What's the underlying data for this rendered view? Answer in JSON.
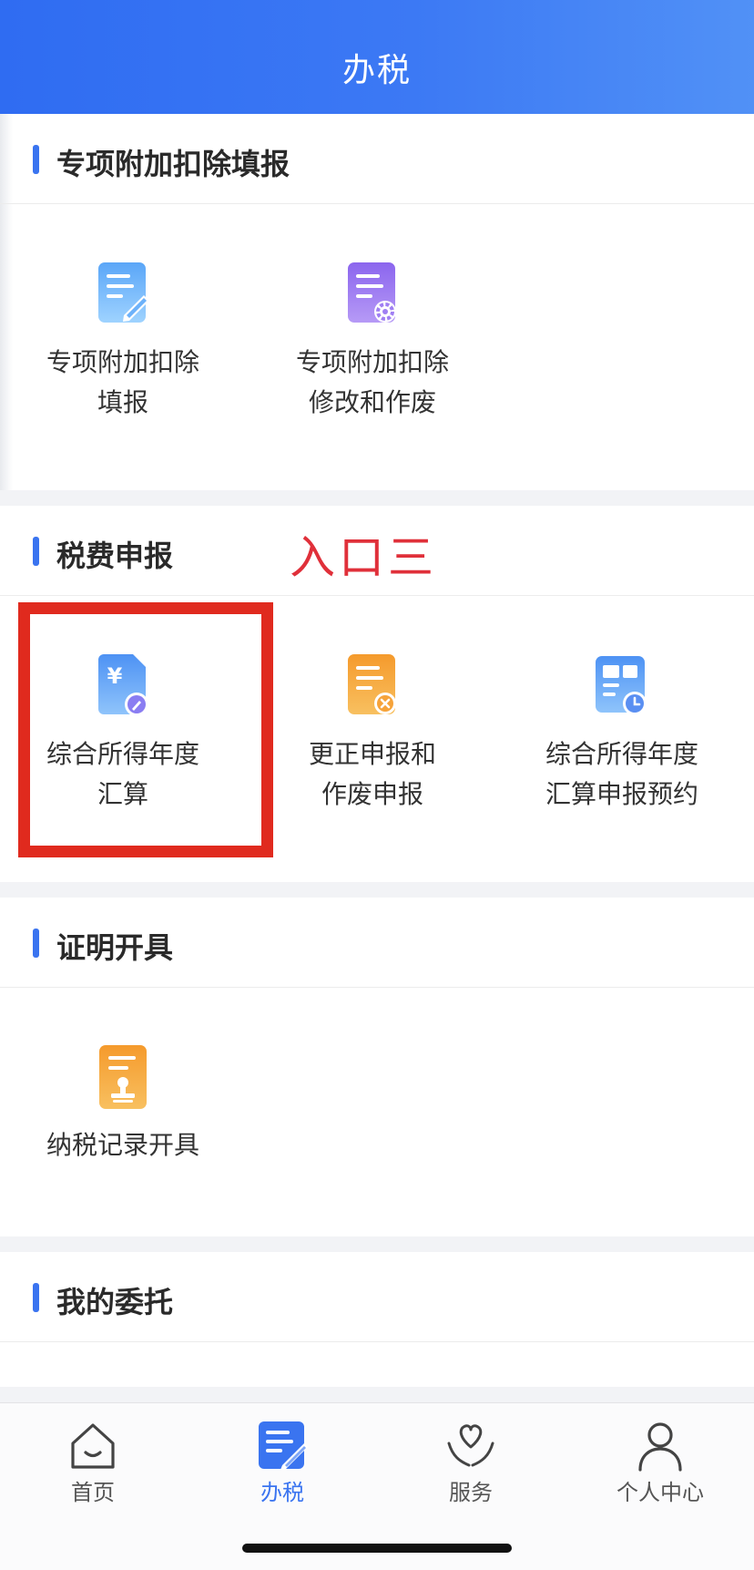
{
  "header": {
    "title": "办税"
  },
  "sections": {
    "deduction": {
      "title": "专项附加扣除填报",
      "items": [
        {
          "line1": "专项附加扣除",
          "line2": "填报",
          "icon": "document-edit-icon"
        },
        {
          "line1": "专项附加扣除",
          "line2": "修改和作废",
          "icon": "document-settings-icon"
        }
      ]
    },
    "declaration": {
      "title": "税费申报",
      "annotation": "入口三",
      "items": [
        {
          "line1": "综合所得年度",
          "line2": "汇算",
          "icon": "yuan-document-icon"
        },
        {
          "line1": "更正申报和",
          "line2": "作废申报",
          "icon": "document-cancel-icon"
        },
        {
          "line1": "综合所得年度",
          "line2": "汇算申报预约",
          "icon": "calendar-clock-icon"
        }
      ]
    },
    "certificate": {
      "title": "证明开具",
      "items": [
        {
          "line1": "纳税记录开具",
          "icon": "document-stamp-icon"
        }
      ]
    },
    "entrust": {
      "title": "我的委托"
    }
  },
  "tabbar": {
    "tabs": [
      {
        "label": "首页",
        "icon": "home-icon"
      },
      {
        "label": "办税",
        "icon": "tax-document-icon",
        "active": true
      },
      {
        "label": "服务",
        "icon": "heart-hands-icon"
      },
      {
        "label": "个人中心",
        "icon": "person-icon"
      }
    ]
  },
  "colors": {
    "accent": "#3a74f0",
    "highlight": "#e02a1e",
    "annotation": "#e0303a"
  }
}
